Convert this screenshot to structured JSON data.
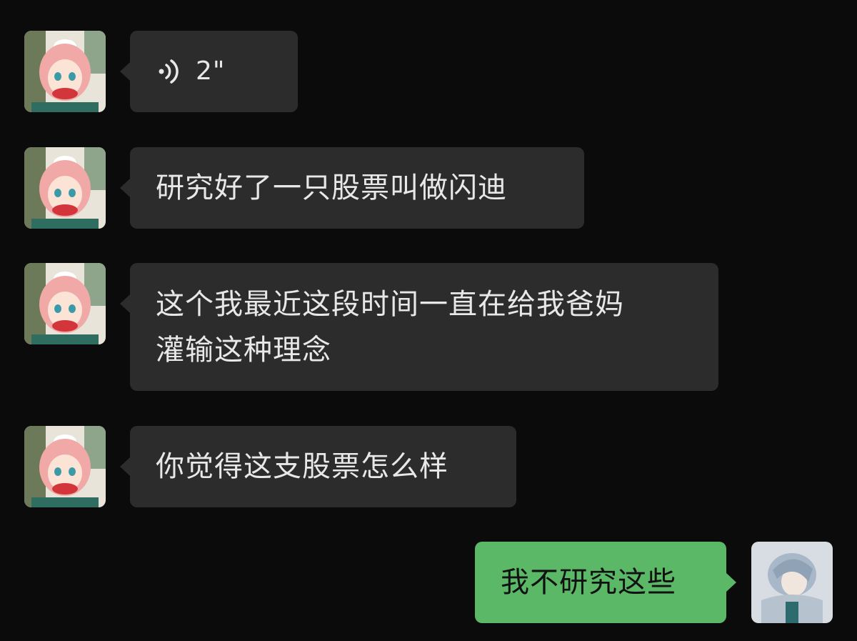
{
  "messages": [
    {
      "sender": "other",
      "type": "voice",
      "duration": "2\""
    },
    {
      "sender": "other",
      "type": "text",
      "text": "研究好了一只股票叫做闪迪"
    },
    {
      "sender": "other",
      "type": "text",
      "lines": [
        "这个我最近这段时间一直在给我爸妈",
        "灌输这种理念"
      ]
    },
    {
      "sender": "other",
      "type": "text",
      "text": "你觉得这支股票怎么样"
    },
    {
      "sender": "me",
      "type": "text",
      "text": "我不研究这些"
    }
  ],
  "colors": {
    "background": "#0b0b0b",
    "bubble_other": "#2c2c2c",
    "bubble_mine": "#5bb867"
  },
  "icons": {
    "voice": "voice-wave-icon",
    "avatar_other": "anime-girl-avatar",
    "avatar_me": "anime-boy-avatar"
  }
}
